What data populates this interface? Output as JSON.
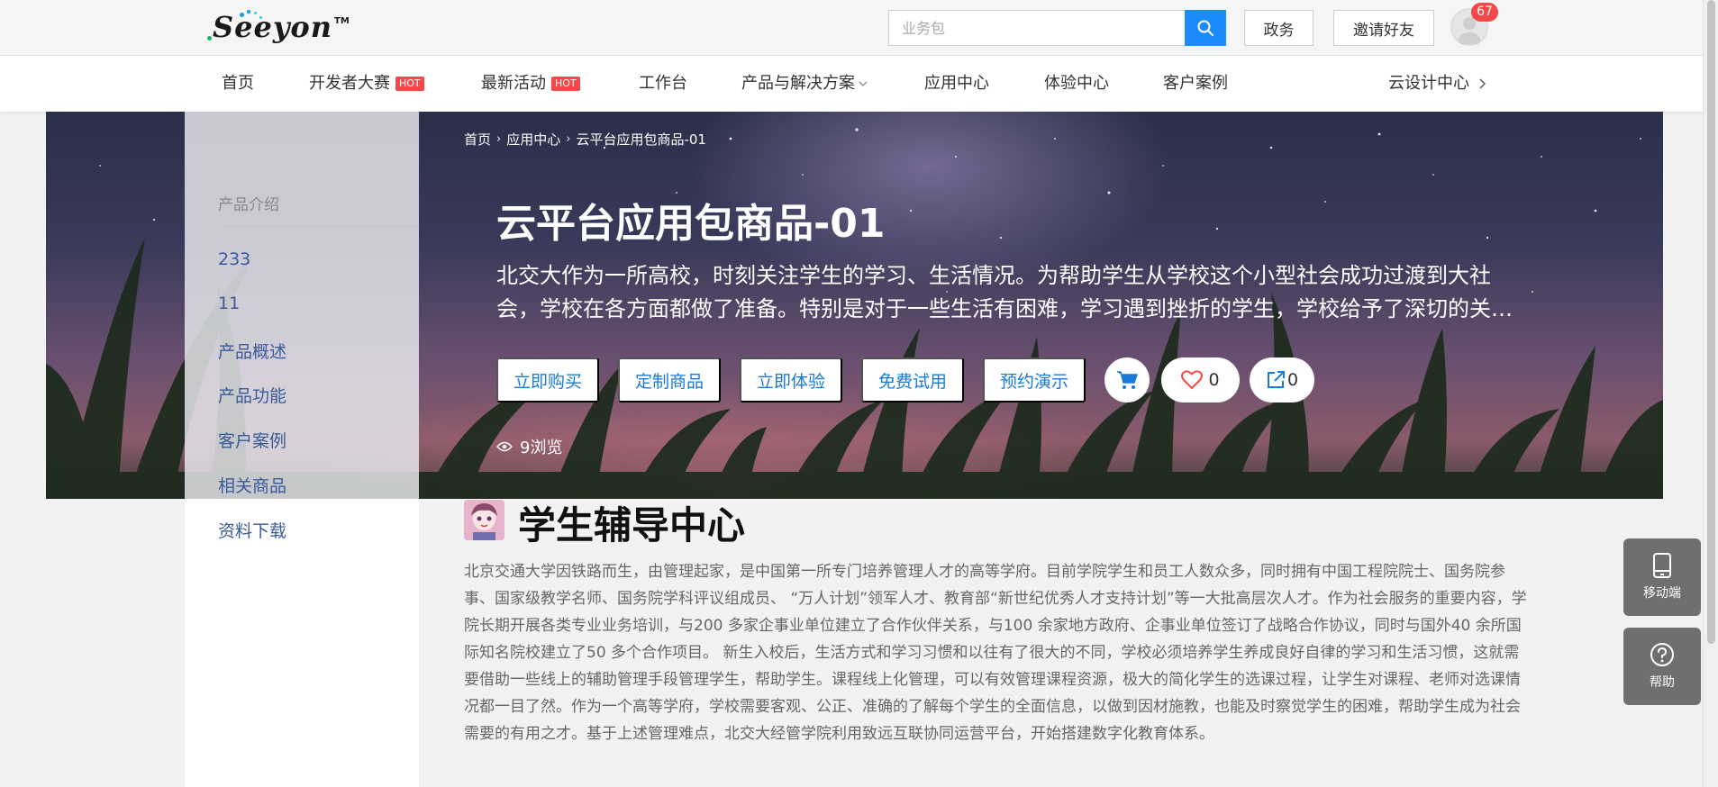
{
  "brand": {
    "logo_text": "Seeyon",
    "tm": "TM"
  },
  "header": {
    "search_placeholder": "业务包",
    "btn_gov": "政务",
    "btn_invite": "邀请好友",
    "notification_count": "67"
  },
  "nav": {
    "items": [
      {
        "label": "首页"
      },
      {
        "label": "开发者大赛",
        "badge": "HOT"
      },
      {
        "label": "最新活动",
        "badge": "HOT"
      },
      {
        "label": "工作台"
      },
      {
        "label": "产品与解决方案"
      },
      {
        "label": "应用中心"
      },
      {
        "label": "体验中心"
      },
      {
        "label": "客户案例"
      }
    ],
    "right_label": "云设计中心"
  },
  "sidebar": {
    "title": "产品介绍",
    "items": [
      {
        "label": "233"
      },
      {
        "label": "11"
      },
      {
        "label": "产品概述"
      },
      {
        "label": "产品功能"
      },
      {
        "label": "客户案例"
      },
      {
        "label": "相关商品"
      },
      {
        "label": "资料下载"
      }
    ]
  },
  "breadcrumb": [
    "首页",
    "应用中心",
    "云平台应用包商品-01"
  ],
  "product": {
    "title": "云平台应用包商品-01",
    "description": "北交大作为一所高校，时刻关注学生的学习、生活情况。为帮助学生从学校这个小型社会成功过渡到大社会，学校在各方面都做了准备。特别是对于一些生活有困难，学习遇到挫折的学生，学校给予了深切的关怀。",
    "actions": [
      "立即购买",
      "定制商品",
      "立即体验",
      "免费试用",
      "预约演示"
    ],
    "like_count": "0",
    "share_count": "0",
    "views": "9浏览"
  },
  "content": {
    "title": "学生辅导中心",
    "body": "北京交通大学因铁路而生，由管理起家，是中国第一所专门培养管理人才的高等学府。目前学院学生和员工人数众多，同时拥有中国工程院院士、国务院参事、国家级教学名师、国务院学科评议组成员、 “万人计划”领军人才、教育部“新世纪优秀人才支持计划”等一大批高层次人才。作为社会服务的重要内容，学院长期开展各类专业业务培训，与200 多家企事业单位建立了合作伙伴关系，与100 余家地方政府、企事业单位签订了战略合作协议，同时与国外40 余所国际知名院校建立了50 多个合作项目。 新生入校后，生活方式和学习习惯和以往有了很大的不同，学校必须培养学生养成良好自律的学习和生活习惯，这就需要借助一些线上的辅助管理手段管理学生，帮助学生。课程线上化管理，可以有效管理课程资源，极大的简化学生的选课过程，让学生对课程、老师对选课情况都一目了然。作为一个高等学府，学校需要客观、公正、准确的了解每个学生的全面信息，以做到因材施教，也能及时察觉学生的困难，帮助学生成为社会需要的有用之才。基于上述管理难点，北交大经管学院利用致远互联协同运营平台，开始搭建数字化教育体系。"
  },
  "floating": {
    "mobile_label": "移动端",
    "help_label": "帮助"
  },
  "colors": {
    "accent": "#1a8cff",
    "hot": "#f54848",
    "link": "#3a5a9a"
  }
}
